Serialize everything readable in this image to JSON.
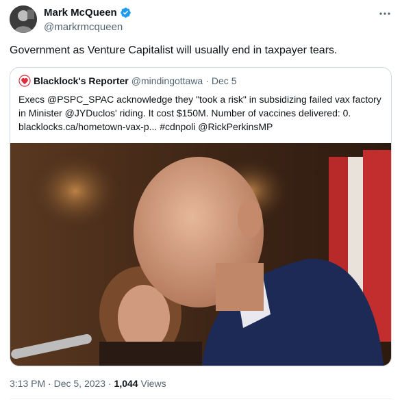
{
  "author": {
    "display_name": "Mark McQueen",
    "handle": "@markrmcqueen",
    "verified": true
  },
  "tweet": {
    "text": "Government as Venture Capitalist will usually end in taxpayer tears."
  },
  "quoted_tweet": {
    "display_name": "Blacklock's Reporter",
    "handle": "@mindingottawa",
    "separator": "·",
    "date": "Dec 5",
    "text": "Execs @PSPC_SPAC acknowledge they \"took a risk\" in subsidizing failed vax factory in Minister @JYDuclos' riding. It cost $150M. Number of vaccines delivered: 0.   blacklocks.ca/hometown-vax-p... #cdnpoli @RickPerkinsMP"
  },
  "meta": {
    "time": "3:13 PM",
    "separator": "·",
    "date": "Dec 5, 2023",
    "views_count": "1,044",
    "views_label": "Views"
  },
  "colors": {
    "verified_blue": "#1d9bf0",
    "text_primary": "#0f1419",
    "text_secondary": "#536471",
    "border": "#cfd9de",
    "logo_red": "#d9303c"
  },
  "icons": {
    "verified": "verified-badge-icon",
    "more": "more-options-icon",
    "quote_logo": "blacklocks-logo-icon"
  }
}
